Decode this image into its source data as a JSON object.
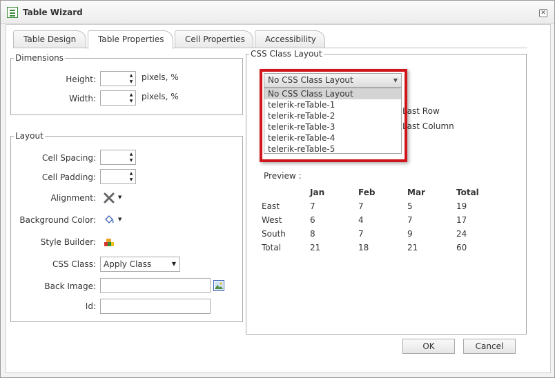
{
  "window": {
    "title": "Table Wizard"
  },
  "tabs": [
    {
      "label": "Table Design"
    },
    {
      "label": "Table Properties",
      "active": true
    },
    {
      "label": "Cell Properties"
    },
    {
      "label": "Accessibility"
    }
  ],
  "dimensions": {
    "legend": "Dimensions",
    "height_label": "Height:",
    "width_label": "Width:",
    "height_value": "",
    "width_value": "",
    "unit": "pixels, %"
  },
  "layout": {
    "legend": "Layout",
    "cell_spacing_label": "Cell Spacing:",
    "cell_padding_label": "Cell Padding:",
    "alignment_label": "Alignment:",
    "background_color_label": "Background Color:",
    "style_builder_label": "Style Builder:",
    "css_class_label": "CSS Class:",
    "css_class_value": "Apply Class",
    "back_image_label": "Back Image:",
    "id_label": "Id:"
  },
  "css_class_layout": {
    "legend": "CSS Class Layout",
    "selected": "No CSS Class Layout",
    "options": [
      "No CSS Class Layout",
      "telerik-reTable-1",
      "telerik-reTable-2",
      "telerik-reTable-3",
      "telerik-reTable-4",
      "telerik-reTable-5"
    ],
    "hidden_options": {
      "last_row": "Last Row",
      "last_column": "Last Column"
    }
  },
  "preview": {
    "label": "Preview :",
    "headers": [
      "",
      "Jan",
      "Feb",
      "Mar",
      "Total"
    ],
    "rows": [
      [
        "East",
        "7",
        "7",
        "5",
        "19"
      ],
      [
        "West",
        "6",
        "4",
        "7",
        "17"
      ],
      [
        "South",
        "8",
        "7",
        "9",
        "24"
      ],
      [
        "Total",
        "21",
        "18",
        "21",
        "60"
      ]
    ]
  },
  "buttons": {
    "ok": "OK",
    "cancel": "Cancel"
  },
  "colors": {
    "highlight": "#d0161a",
    "selected_item": "#d4d4d4"
  }
}
